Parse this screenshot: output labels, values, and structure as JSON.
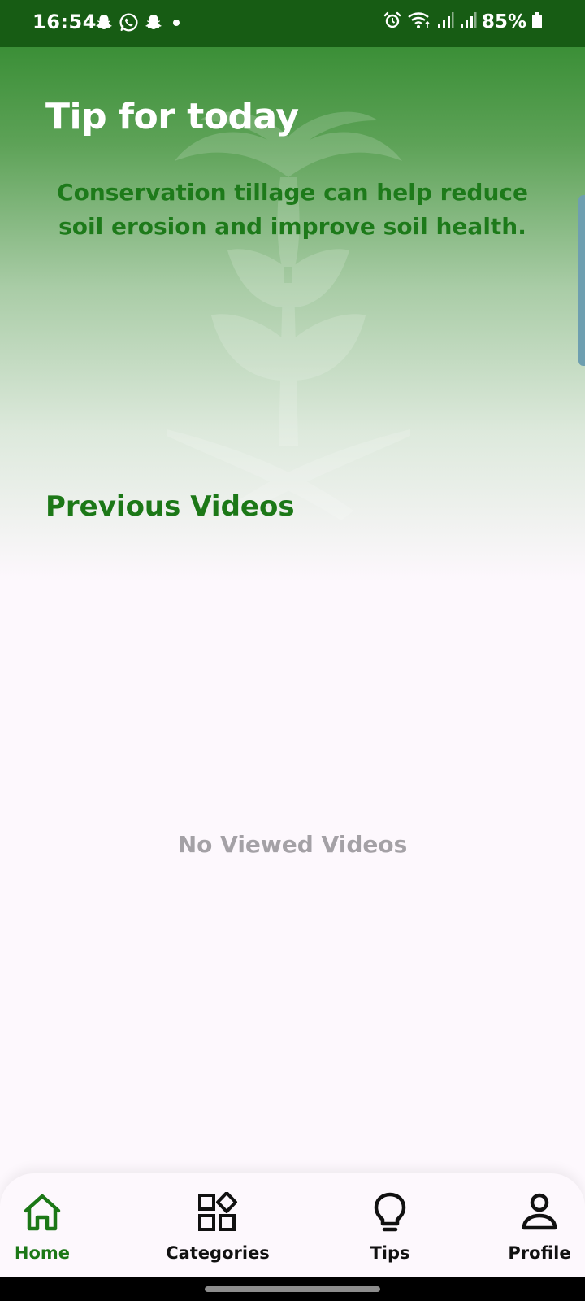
{
  "status_bar": {
    "time": "16:54",
    "battery": "85%",
    "notification_icons": [
      "snapchat-icon",
      "whatsapp-icon",
      "snapchat-icon",
      "dot-icon"
    ],
    "system_icons": [
      "alarm-icon",
      "wifi-icon",
      "signal-icon",
      "signal-icon",
      "battery-icon"
    ]
  },
  "hero": {
    "title": "Tip for today",
    "tip": "Conservation tillage can help reduce soil erosion and improve soil health."
  },
  "previous_videos": {
    "title": "Previous Videos",
    "empty_message": "No Viewed Videos"
  },
  "bottom_nav": {
    "items": [
      {
        "label": "Home",
        "icon": "home-icon",
        "active": true
      },
      {
        "label": "Categories",
        "icon": "categories-icon",
        "active": false
      },
      {
        "label": "Tips",
        "icon": "lightbulb-icon",
        "active": false
      },
      {
        "label": "Profile",
        "icon": "person-icon",
        "active": false
      }
    ]
  },
  "colors": {
    "primary_green": "#1c7817",
    "status_bar": "#175c14",
    "background": "#fdf8fd",
    "muted_text": "#a4a1a6"
  }
}
